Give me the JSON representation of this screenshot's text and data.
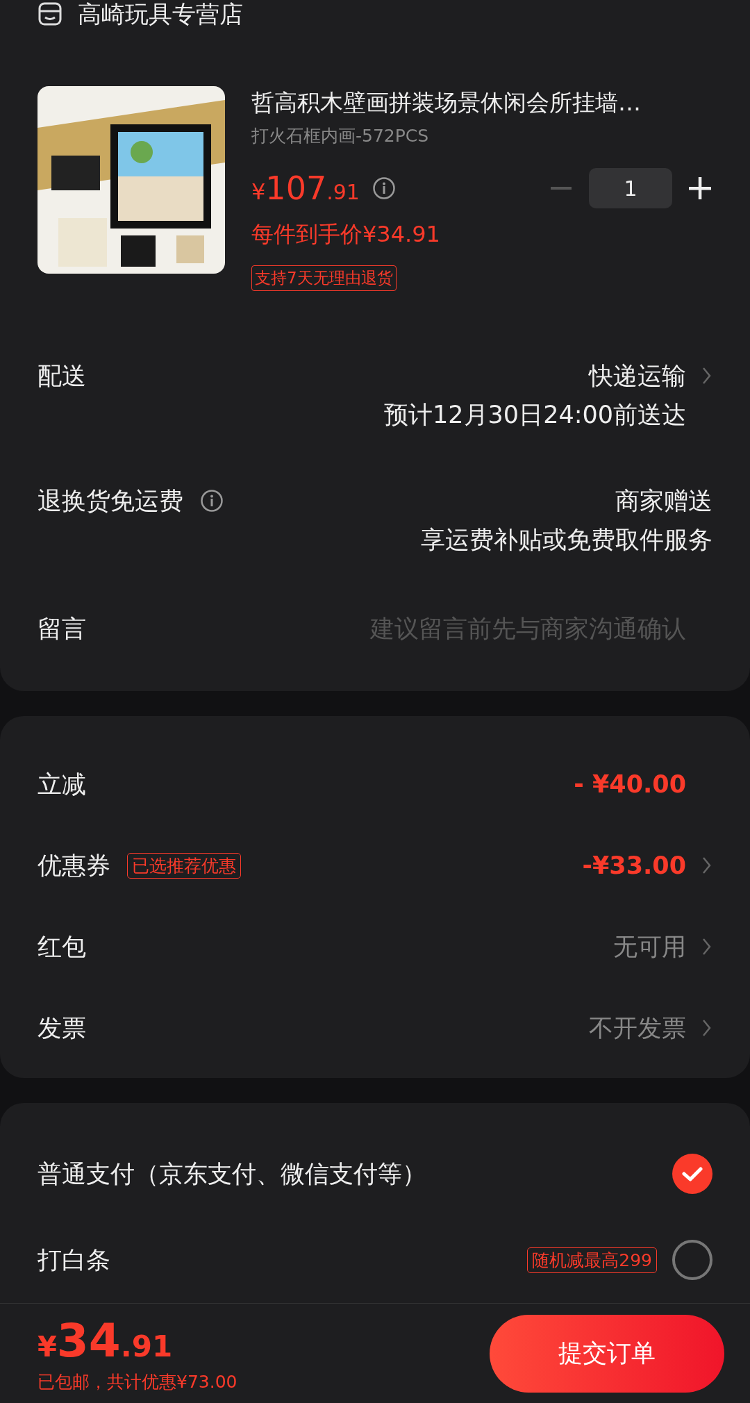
{
  "store": {
    "name": "高崎玩具专营店"
  },
  "product": {
    "title": "哲高积木壁画拼装场景休闲会所挂墙…",
    "spec": "打火石框内画-572PCS",
    "price_currency": "¥",
    "price_int": "107",
    "price_dec": ".91",
    "unit_price": "每件到手价¥34.91",
    "quantity": "1",
    "minus_disabled": true,
    "return_badge": "支持7天无理由退货"
  },
  "delivery": {
    "label": "配送",
    "method": "快递运输",
    "eta": "预计12月30日24:00前送达"
  },
  "return_shipping": {
    "label": "退换货免运费",
    "value": "商家赠送",
    "detail": "享运费补贴或免费取件服务"
  },
  "message": {
    "label": "留言",
    "placeholder": "建议留言前先与商家沟通确认"
  },
  "discounts": [
    {
      "kind": "amount",
      "label": "立减",
      "value": "- ¥40.00",
      "chevron": false
    },
    {
      "kind": "amount",
      "label": "优惠券",
      "tag": "已选推荐优惠",
      "value": "-¥33.00",
      "chevron": true
    },
    {
      "kind": "plain",
      "label": "红包",
      "value": "无可用",
      "chevron": true
    },
    {
      "kind": "plain",
      "label": "发票",
      "value": "不开发票",
      "chevron": true
    }
  ],
  "payments": [
    {
      "label": "普通支付（京东支付、微信支付等）",
      "selected": true
    },
    {
      "label": "打白条",
      "promo": "随机减最高299",
      "selected": false
    }
  ],
  "footer": {
    "currency": "¥",
    "total_int": "34",
    "total_dec": ".91",
    "note": "已包邮，共计优惠¥73.00",
    "submit": "提交订单"
  }
}
